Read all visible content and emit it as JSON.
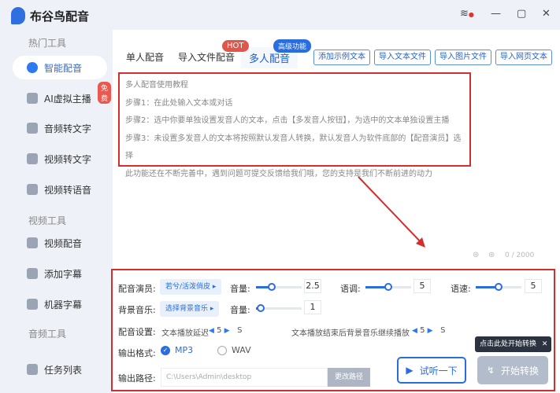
{
  "app": {
    "title": "布谷鸟配音"
  },
  "sidebar": {
    "sections": [
      "热门工具",
      "视频工具",
      "音频工具"
    ],
    "items": [
      {
        "label": "智能配音"
      },
      {
        "label": "AI虚拟主播",
        "badge": "免费"
      },
      {
        "label": "音频转文字"
      },
      {
        "label": "视频转文字"
      },
      {
        "label": "视频转语音"
      },
      {
        "label": "视频配音"
      },
      {
        "label": "添加字幕"
      },
      {
        "label": "机器字幕"
      },
      {
        "label": "任务列表"
      }
    ]
  },
  "tabs": [
    {
      "label": "单人配音"
    },
    {
      "label": "导入文件配音"
    },
    {
      "label": "多人配音"
    }
  ],
  "tags": {
    "hot": "HOT",
    "advanced": "高级功能"
  },
  "toolbar": [
    "添加示例文本",
    "导入文本文件",
    "导入图片文件",
    "导入网页文本"
  ],
  "editor": {
    "lines": [
      "多人配音使用教程",
      "步骤1：在此处输入文本或对话",
      "步骤2：选中你要单独设置发音人的文本，点击【多发音人按钮】，为选中的文本单独设置主播",
      "步骤3：未设置多发音人的文本将按照默认发音人转换，默认发音人为软件底部的【配音演员】选择",
      "此功能还在不断完善中，遇到问题可提交反馈给我们哦，您的支持是我们不断前进的动力"
    ],
    "counter": "0 / 2000"
  },
  "settings": {
    "actor_label": "配音演员:",
    "actor_value": "若兮/活泼俏皮",
    "volume_label": "音量:",
    "volume": "2.5",
    "volume_frac": 0.35,
    "pitch_label": "语调:",
    "pitch": "5",
    "pitch_frac": 0.5,
    "speed_label": "语速:",
    "speed": "5",
    "speed_frac": 0.5,
    "bgm_label": "背景音乐:",
    "bgm_value": "选择背景音乐",
    "bgm_volume_label": "音量:",
    "bgm_volume": "1",
    "bgm_volume_frac": 0.1,
    "config_label": "配音设置:",
    "delay_label": "文本播放延迟",
    "delay": "5",
    "delay_unit": "S",
    "continue_label": "文本播放结束后背景音乐继续播放",
    "continue": "5",
    "continue_unit": "S",
    "format_label": "输出格式:",
    "formats": [
      "MP3",
      "WAV"
    ],
    "path_label": "输出路径:",
    "path": "C:\\Users\\Admin\\desktop",
    "change_path": "更改路径",
    "preview": "试听一下",
    "start": "开始转换",
    "tooltip": "点击此处开始转换"
  },
  "colors": {
    "accent": "#2b6de0",
    "highlight": "#d32f2f"
  }
}
